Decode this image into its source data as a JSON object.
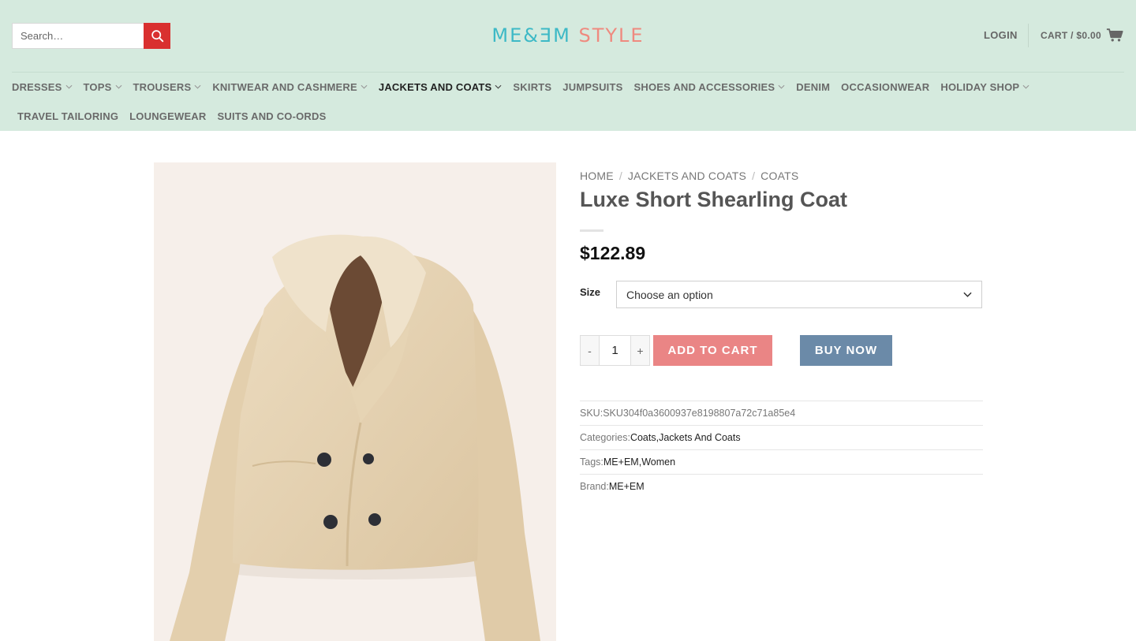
{
  "header": {
    "search_placeholder": "Search…",
    "logo_part1": "ME&ƎM",
    "logo_part2": "STYLE",
    "login_label": "LOGIN",
    "cart_label": "CART / $0.00"
  },
  "nav": {
    "row1": [
      {
        "label": "DRESSES",
        "dropdown": true
      },
      {
        "label": "TOPS",
        "dropdown": true
      },
      {
        "label": "TROUSERS",
        "dropdown": true
      },
      {
        "label": "KNITWEAR AND CASHMERE",
        "dropdown": true
      },
      {
        "label": "JACKETS AND COATS",
        "dropdown": true,
        "active": true
      },
      {
        "label": "SKIRTS",
        "dropdown": false
      },
      {
        "label": "JUMPSUITS",
        "dropdown": false
      },
      {
        "label": "SHOES AND ACCESSORIES",
        "dropdown": true
      },
      {
        "label": "DENIM",
        "dropdown": false
      },
      {
        "label": "OCCASIONWEAR",
        "dropdown": false
      },
      {
        "label": "HOLIDAY SHOP",
        "dropdown": true
      }
    ],
    "row2": [
      {
        "label": "TRAVEL TAILORING"
      },
      {
        "label": "LOUNGEWEAR"
      },
      {
        "label": "SUITS AND CO-ORDS"
      }
    ]
  },
  "breadcrumb": {
    "home": "HOME",
    "sep": "/",
    "cat": "JACKETS AND COATS",
    "sub": "COATS"
  },
  "product": {
    "title": "Luxe Short Shearling Coat",
    "price": "$122.89",
    "size_label": "Size",
    "size_placeholder": "Choose an option",
    "qty_minus": "-",
    "qty_value": "1",
    "qty_plus": "+",
    "add_to_cart": "ADD TO CART",
    "buy_now": "BUY NOW",
    "image_alt": "Luxe Short Shearling Coat product image"
  },
  "meta": {
    "sku_label": "SKU: ",
    "sku_value": "SKU304f0a3600937e8198807a72c71a85e4",
    "categories_label": "Categories: ",
    "cat1": "Coats",
    "comma": ", ",
    "cat2": "Jackets And Coats",
    "tags_label": "Tags: ",
    "tag1": "ME+EM",
    "tag2": "Women",
    "brand_label": "Brand: ",
    "brand_value": "ME+EM"
  },
  "colors": {
    "header_bg": "#d5eade",
    "search_button": "#d9302f",
    "logo_teal": "#3db9c6",
    "logo_coral": "#ef8a7f",
    "add_to_cart": "#ea8585",
    "buy_now": "#6b8aa8",
    "image_bg": "#f6efea"
  },
  "icons": {
    "search": "search-icon",
    "cart": "cart-icon",
    "chevron": "chevron-down-icon"
  }
}
